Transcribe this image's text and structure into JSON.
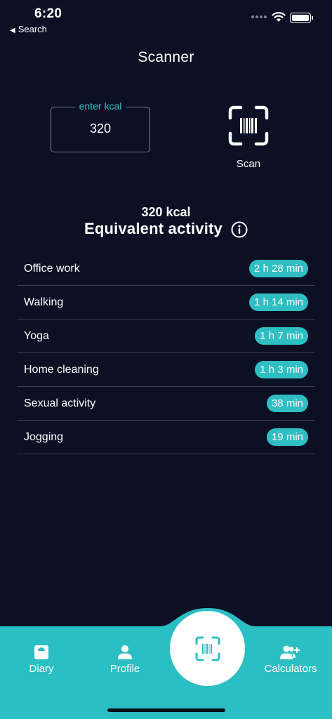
{
  "status_bar": {
    "time": "6:20",
    "back_label": "Search"
  },
  "header": {
    "title": "Scanner"
  },
  "kcal_input": {
    "label": "enter kcal",
    "value": "320"
  },
  "scan": {
    "label": "Scan"
  },
  "summary": {
    "kcal_text": "320 kcal",
    "heading": "Equivalent activity"
  },
  "activities": [
    {
      "name": "Office work",
      "duration": "2 h 28 min"
    },
    {
      "name": "Walking",
      "duration": "1 h 14 min"
    },
    {
      "name": "Yoga",
      "duration": "1 h 7 min"
    },
    {
      "name": "Home cleaning",
      "duration": "1 h 3 min"
    },
    {
      "name": "Sexual activity",
      "duration": "38 min"
    },
    {
      "name": "Jogging",
      "duration": "19 min"
    }
  ],
  "nav": {
    "diary": "Diary",
    "profile": "Profile",
    "calculators": "Calculators"
  },
  "colors": {
    "background": "#0c1024",
    "accent": "#2fbfc3",
    "nav_bg": "#2bbfc4"
  }
}
